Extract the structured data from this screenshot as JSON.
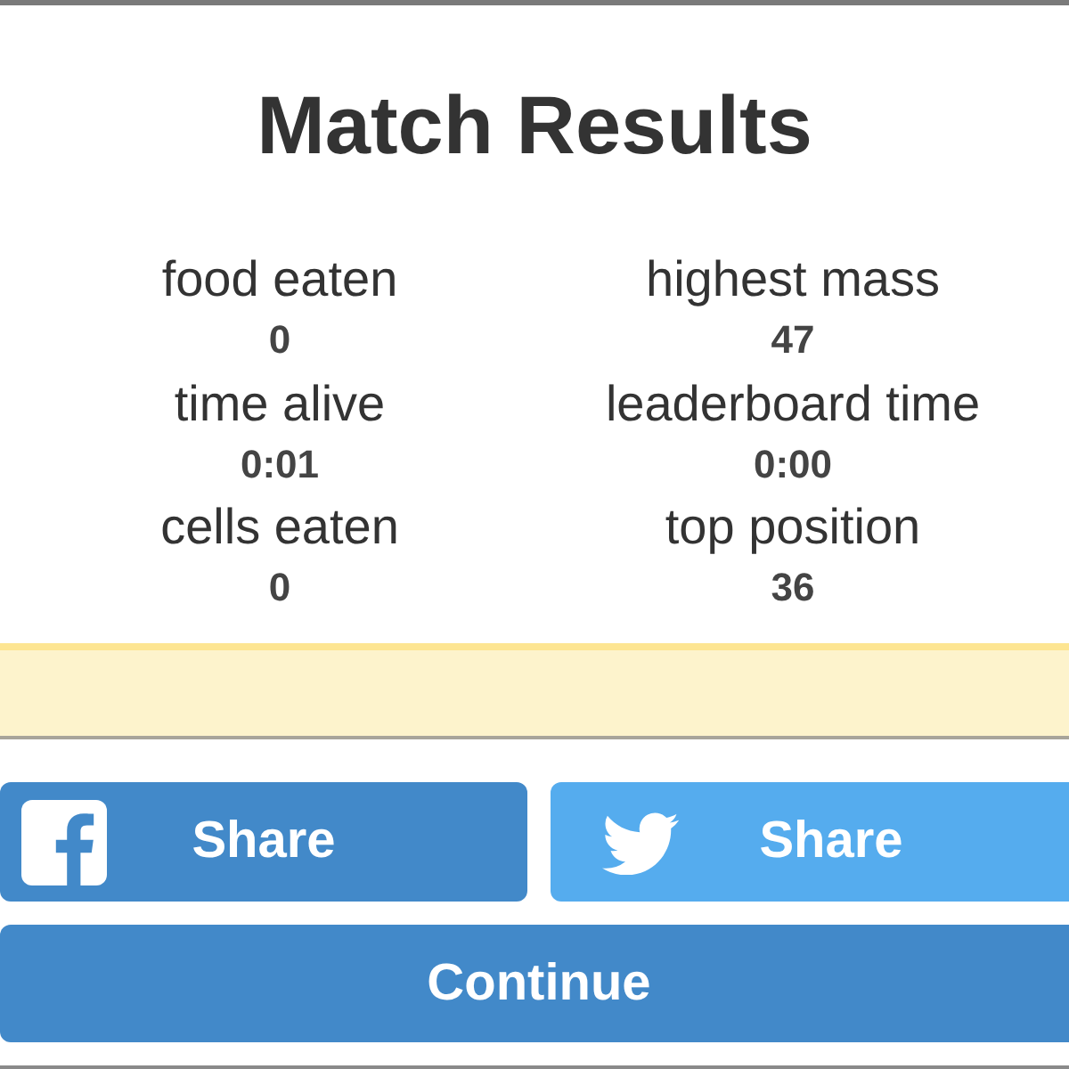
{
  "title": "Match Results",
  "stats": [
    {
      "label": "food eaten",
      "value": "0"
    },
    {
      "label": "highest mass",
      "value": "47"
    },
    {
      "label": "time alive",
      "value": "0:01"
    },
    {
      "label": "leaderboard time",
      "value": "0:00"
    },
    {
      "label": "cells eaten",
      "value": "0"
    },
    {
      "label": "top position",
      "value": "36"
    }
  ],
  "share_buttons": [
    {
      "kind": "facebook",
      "label": "Share"
    },
    {
      "kind": "twitter",
      "label": "Share"
    }
  ],
  "continue_button": {
    "label": "Continue"
  }
}
